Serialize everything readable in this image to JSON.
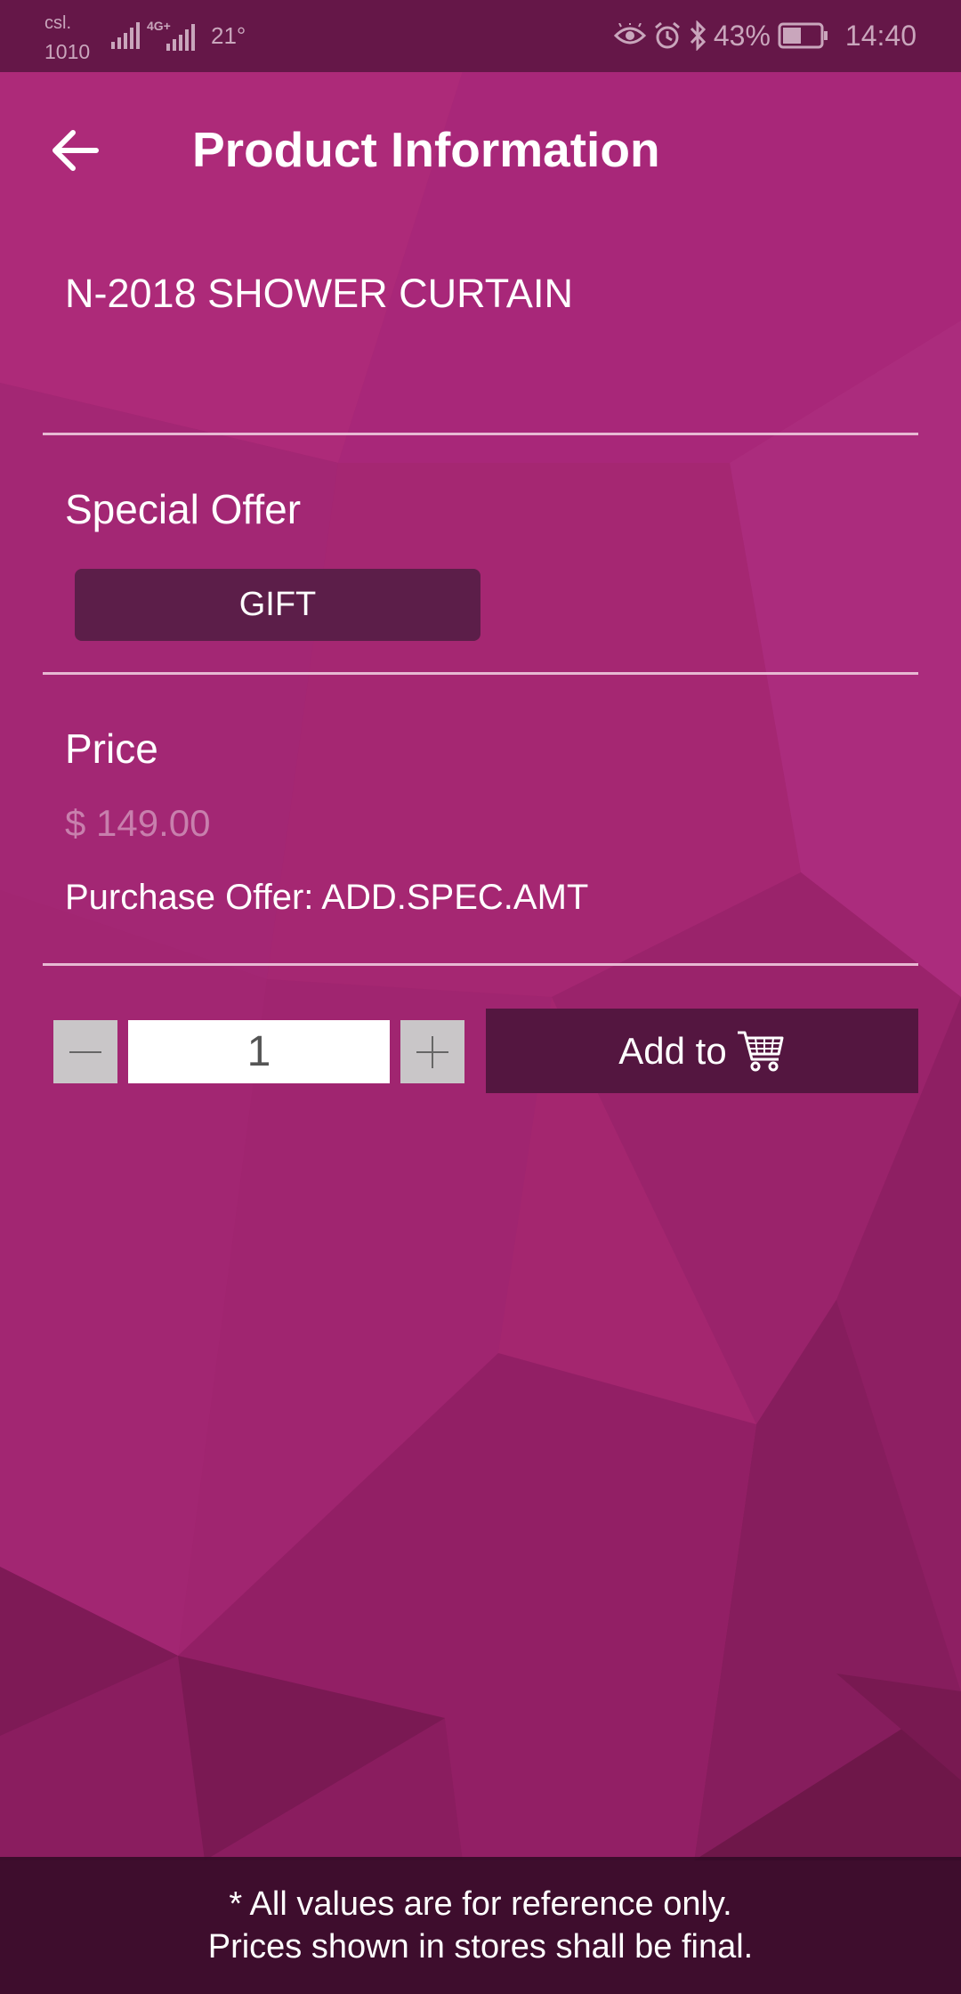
{
  "status_bar": {
    "carrier_line1": "csl.",
    "carrier_line2": "1010",
    "network_label": "4G+",
    "temperature": "21°",
    "battery_percent": "43%",
    "time": "14:40",
    "icons": [
      "signal-icon",
      "signal-4g-icon",
      "eye-icon",
      "alarm-icon",
      "bluetooth-icon",
      "battery-icon"
    ]
  },
  "header": {
    "title": "Product Information",
    "back_icon": "arrow-left-icon"
  },
  "product": {
    "name": "N-2018 SHOWER CURTAIN"
  },
  "special_offer": {
    "label": "Special Offer",
    "button_label": "GIFT"
  },
  "price": {
    "label": "Price",
    "value": "$ 149.00",
    "purchase_offer": "Purchase Offer: ADD.SPEC.AMT"
  },
  "quantity": {
    "value": "1",
    "minus_icon": "minus-icon",
    "plus_icon": "plus-icon"
  },
  "cart": {
    "button_label": "Add to",
    "icon": "shopping-cart-icon"
  },
  "footer": {
    "line1": "* All values are for reference only.",
    "line2": "Prices shown in stores shall be final."
  },
  "colors": {
    "background": "#a4266f",
    "status_bar": "#651748",
    "gift_button": "#5c1e49",
    "cart_button": "#541640",
    "price_text": "#c87fad",
    "stepper_button": "#c9c6c8"
  }
}
